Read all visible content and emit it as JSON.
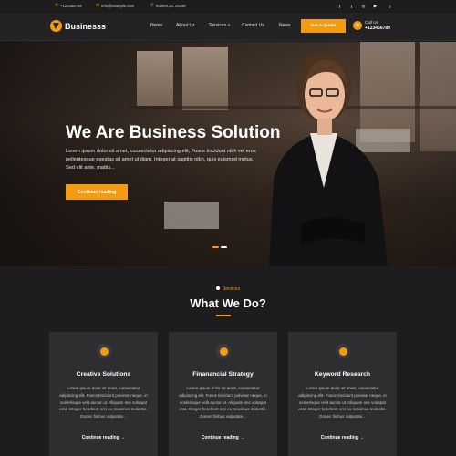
{
  "topbar": {
    "phone": "+123456789",
    "email": "info@example.com",
    "address": "Sumter,SC 29150",
    "socials": [
      "facebook-icon",
      "twitter-icon",
      "instagram-icon",
      "youtube-icon"
    ]
  },
  "header": {
    "brand": "Businesss",
    "nav": [
      "Home",
      "About Us",
      "Services +",
      "Contact Us",
      "News"
    ],
    "quote_label": "Get A Quote",
    "call_label": "Call Us",
    "call_number": "+123456789"
  },
  "hero": {
    "title": "We Are Business Solution",
    "text": "Lorem ipsum dolor sit amet, consectetur adipiscing elit, Fusce tincidunt nibh vel eros pellentesque egestas sit amet ut diam. Integer at sagittis nibh, quis euismod metus. Sed elit ante, mattis...",
    "button": "Continue reading",
    "slides": 2,
    "active_slide": 1
  },
  "services": {
    "tag": "Services",
    "title": "What We Do?",
    "cards": [
      {
        "icon": "layers-icon",
        "title": "Creative Solutions",
        "text": "Lorem ipsum dolor sit amet, consectetur adipiscing elit. Fusce tincidunt pulvinar neque, in scelerisque velit auctor ut. Aliquam nec volutpat erat. Integer hendrerit orci eu maximus molestie. Donec finibus vulputate...",
        "link": "Continue reading →"
      },
      {
        "icon": "money-icon",
        "title": "Finanancial Strategy",
        "text": "Lorem ipsum dolor sit amet, consectetur adipiscing elit. Fusce tincidunt pulvinar neque, in scelerisque velit auctor ut. Aliquam nec volutpat erat. Integer hendrerit orci eu maximus molestie. Donec finibus vulputate...",
        "link": "Continue reading →"
      },
      {
        "icon": "chart-icon",
        "title": "Keyword Research",
        "text": "Lorem ipsum dolor sit amet, consectetur adipiscing elit. Fusce tincidunt pulvinar neque, in scelerisque velit auctor ut. Aliquam nec volutpat erat. Integer hendrerit orci eu maximus molestie. Donec finibus vulputate...",
        "link": "Continue reading →"
      }
    ]
  },
  "colors": {
    "accent": "#f39c12",
    "background": "#1d1d1f",
    "card": "#2e2e31"
  }
}
